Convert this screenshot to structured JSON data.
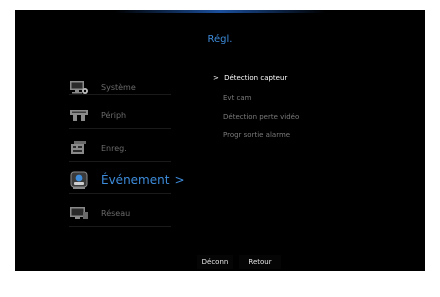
{
  "header": {
    "title": "Régl."
  },
  "sidebar": {
    "items": [
      {
        "label": "Système",
        "icon": "monitor-gear-icon"
      },
      {
        "label": "Périph",
        "icon": "device-icon"
      },
      {
        "label": "Enreg.",
        "icon": "recording-icon"
      },
      {
        "label": "Événement",
        "icon": "event-icon",
        "active_marker": ">"
      },
      {
        "label": "Réseau",
        "icon": "network-icon"
      }
    ]
  },
  "submenu": {
    "marker": ">",
    "items": [
      {
        "label": "Détection capteur"
      },
      {
        "label": "Evt cam"
      },
      {
        "label": "Détection perte vidéo"
      },
      {
        "label": "Progr sortie alarme"
      }
    ]
  },
  "footer": {
    "disconnect_label": "Déconn",
    "back_label": "Retour"
  },
  "colors": {
    "accent": "#3d8cdb",
    "background": "#000000",
    "muted_text": "#6b6b6b"
  }
}
